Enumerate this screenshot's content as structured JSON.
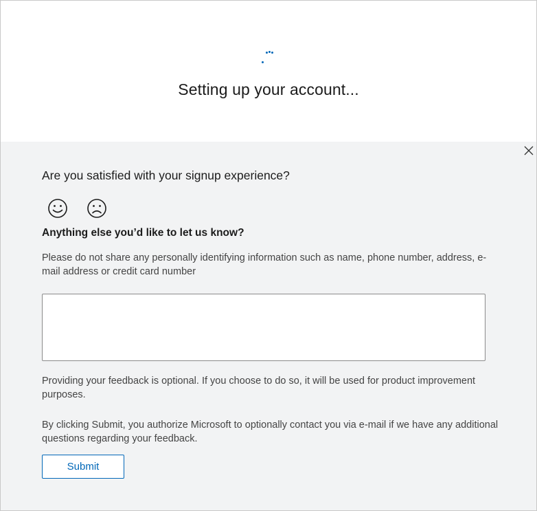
{
  "header": {
    "title": "Setting up your account..."
  },
  "feedback": {
    "question_satisfaction": "Are you satisfied with your signup experience?",
    "question_anything_else": "Anything else you’d like to let us know?",
    "privacy_note": "Please do not share any personally identifying information such as name, phone number, address, e-mail address or credit card number",
    "textarea_value": "",
    "optional_note": "Providing your feedback is optional. If you choose to do so, it will be used for product improvement purposes.",
    "authorize_note": "By clicking Submit, you authorize Microsoft to optionally contact you via e-mail if we have any additional questions regarding your feedback.",
    "submit_label": "Submit"
  },
  "icons": {
    "spinner": "loading-spinner-icon",
    "close": "close-icon",
    "happy": "smiley-happy-icon",
    "sad": "smiley-sad-icon"
  },
  "colors": {
    "accent": "#0067b8",
    "panel_background": "#f2f3f4",
    "text_primary": "#1b1b1b",
    "text_secondary": "#444444"
  }
}
